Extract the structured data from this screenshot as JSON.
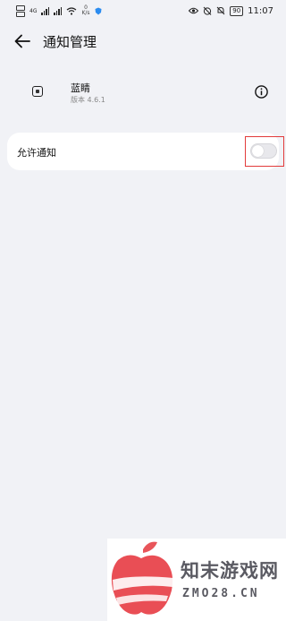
{
  "status_bar": {
    "net_speed_value": "0",
    "net_speed_unit": "K/s",
    "network_label": "4G",
    "battery": "90",
    "time": "11:07"
  },
  "header": {
    "title": "通知管理"
  },
  "app": {
    "name": "蓝睛",
    "version": "版本 4.6.1"
  },
  "settings": {
    "allow_notifications_label": "允许通知",
    "allow_notifications_enabled": false
  },
  "colors": {
    "background": "#f1f2f6",
    "card": "#ffffff",
    "highlight_border": "#e23b3b",
    "toggle_off": "#e8e8ec"
  },
  "watermark": {
    "title": "知末游戏网",
    "domain": "ZMO28.CN"
  }
}
